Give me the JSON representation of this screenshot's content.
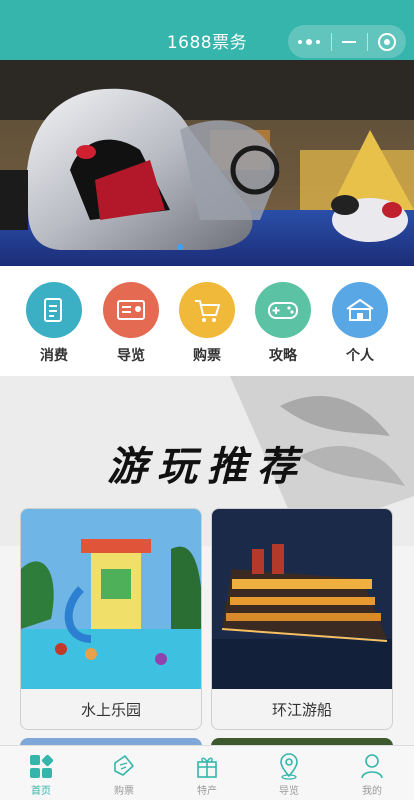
{
  "header": {
    "title": "1688票务"
  },
  "categories": [
    {
      "label": "消费",
      "icon": "document-icon",
      "color": "#3bb0c4"
    },
    {
      "label": "导览",
      "icon": "id-card-icon",
      "color": "#e56a52"
    },
    {
      "label": "购票",
      "icon": "cart-icon",
      "color": "#f1b93a"
    },
    {
      "label": "攻略",
      "icon": "gamepad-icon",
      "color": "#5cc2a4"
    },
    {
      "label": "个人",
      "icon": "house-icon",
      "color": "#5aa7e5"
    }
  ],
  "recommend": {
    "title": "游玩推荐",
    "cards": [
      {
        "caption": "水上乐园"
      },
      {
        "caption": "环江游船"
      }
    ]
  },
  "tabs": [
    {
      "label": "首页",
      "icon": "home-grid-icon",
      "active": true
    },
    {
      "label": "购票",
      "icon": "ticket-icon",
      "active": false
    },
    {
      "label": "特产",
      "icon": "gift-icon",
      "active": false
    },
    {
      "label": "导览",
      "icon": "location-pin-icon",
      "active": false
    },
    {
      "label": "我的",
      "icon": "user-icon",
      "active": false
    }
  ],
  "colors": {
    "brand": "#35b5ab",
    "inactive": "#999999"
  }
}
